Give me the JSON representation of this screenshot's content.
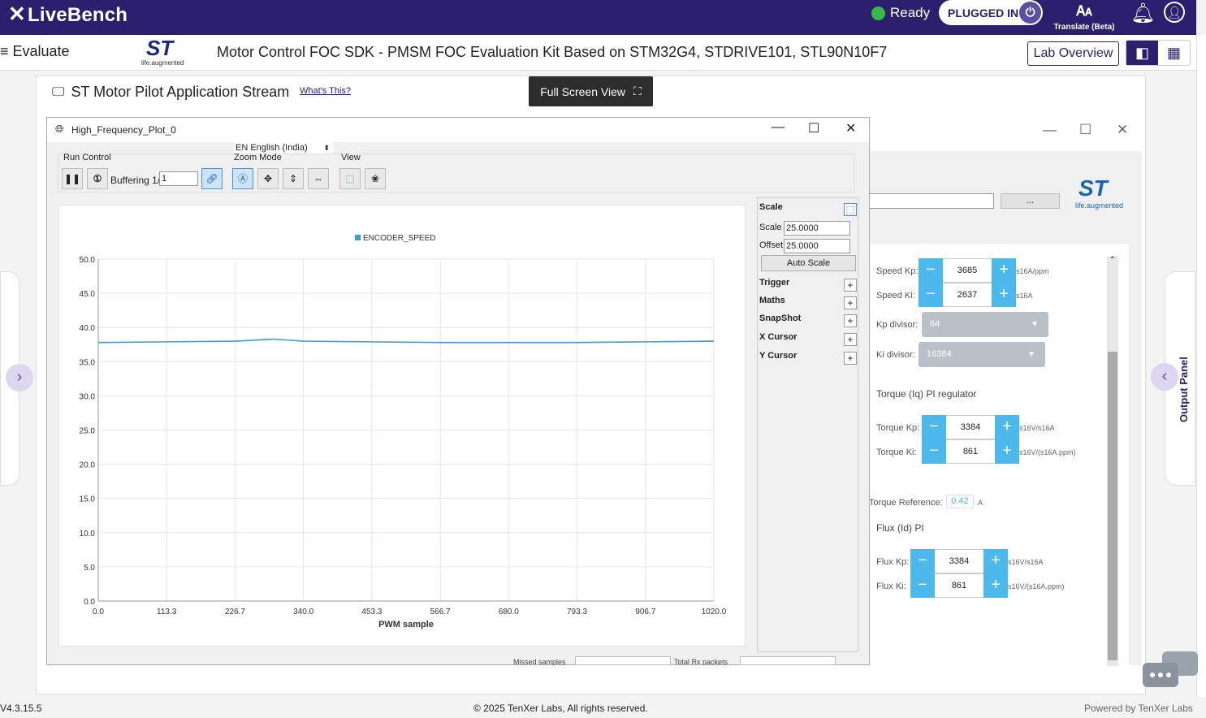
{
  "app": {
    "brand": "LiveBench"
  },
  "topbar": {
    "status": "Ready",
    "status_color": "#3cb54a",
    "plugged": "PLUGGED IN",
    "translate": "Translate (Beta)"
  },
  "subbar": {
    "evaluate": "Evaluate",
    "logo_tagline": "life.augmented",
    "product_title": "Motor Control FOC SDK - PMSM FOC Evaluation Kit Based on STM32G4, STDRIVE101, STL90N10F7",
    "lab_overview": "Lab Overview"
  },
  "stream": {
    "title": "ST Motor Pilot Application Stream",
    "whats_this": "What's This?",
    "fullscreen": "Full Screen View"
  },
  "plot_window": {
    "title": "High_Frequency_Plot_0",
    "language": "EN English (India)",
    "groups": {
      "run": "Run Control",
      "zoom": "Zoom Mode",
      "view": "View"
    },
    "buffering_label": "Buffering 1/",
    "buffering_value": "1"
  },
  "chart_data": {
    "type": "line",
    "legend": "ENCODER_SPEED",
    "series": [
      {
        "name": "ENCODER_SPEED",
        "color": "#3a9bd5",
        "x": [
          0,
          113.3,
          226.7,
          290,
          340,
          453.3,
          566.7,
          680,
          793.3,
          906.7,
          1020
        ],
        "y": [
          37.8,
          37.9,
          38.0,
          38.3,
          38.0,
          37.9,
          37.8,
          37.8,
          37.8,
          37.9,
          38.0
        ]
      }
    ],
    "xlabel": "PWM sample",
    "xlim": [
      0,
      1020
    ],
    "ylim": [
      0,
      50
    ],
    "xticks": [
      "0.0",
      "113.3",
      "226.7",
      "340.0",
      "453.3",
      "566.7",
      "680.0",
      "793.3",
      "906.7",
      "1020.0"
    ],
    "yticks": [
      "0.0",
      "5.0",
      "10.0",
      "15.0",
      "20.0",
      "25.0",
      "30.0",
      "35.0",
      "40.0",
      "45.0",
      "50.0"
    ],
    "grid": true,
    "legend_position": "top-center"
  },
  "side_panel": {
    "scale_header": "Scale",
    "scale_label": "Scale",
    "scale_value": "25.0000",
    "offset_label": "Offset",
    "offset_value": "25.0000",
    "auto_scale": "Auto Scale",
    "sections": [
      "Trigger",
      "Maths",
      "SnapShot",
      "X Cursor",
      "Y Cursor"
    ]
  },
  "bottom_strip": {
    "missed": "Missed samples",
    "total": "Total Rx packets"
  },
  "controls": {
    "speed_kp": {
      "label": "Speed Kp:",
      "value": "3685",
      "unit": "s16A/ppm"
    },
    "speed_ki": {
      "label": "Speed Ki:",
      "value": "2637",
      "unit": "s16A"
    },
    "kp_divisor": {
      "label": "Kp divisor:",
      "value": "64"
    },
    "ki_divisor": {
      "label": "Ki divisor:",
      "value": "16384"
    },
    "torque_section": "Torque (Iq) PI regulator",
    "torque_kp": {
      "label": "Torque Kp:",
      "value": "3384",
      "unit": "s16V/s16A"
    },
    "torque_ki": {
      "label": "Torque Ki:",
      "value": "861",
      "unit": "s16V/(s16A.ppm)"
    },
    "torque_ref": {
      "label": "Torque Reference:",
      "value": "0.42",
      "unit": "A"
    },
    "flux_section": "Flux (Id) PI",
    "flux_kp": {
      "label": "Flux Kp:",
      "value": "3384",
      "unit": "s16V/s16A"
    },
    "flux_ki": {
      "label": "Flux Ki:",
      "value": "861",
      "unit": "s16V/(s16A.ppm)"
    },
    "browse": "..."
  },
  "side": {
    "output_panel": "Output Panel"
  },
  "footer": {
    "version": "V4.3.15.5",
    "copyright": "© 2025 TenXer Labs, All rights reserved.",
    "powered": "Powered by TenXer Labs"
  }
}
